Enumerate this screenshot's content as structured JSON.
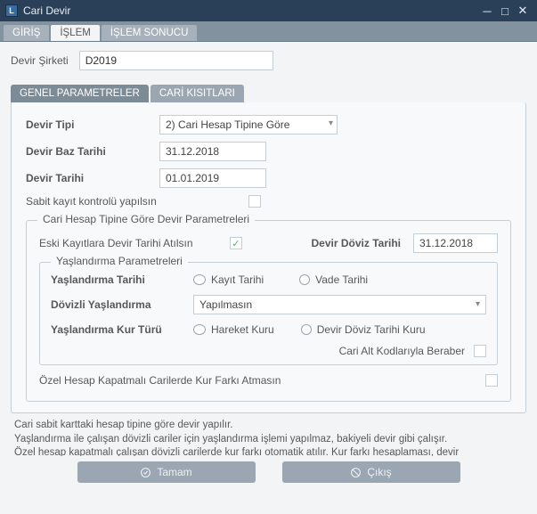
{
  "window": {
    "title": "Cari Devir"
  },
  "tabs": {
    "giris": "GİRİŞ",
    "islem": "İŞLEM",
    "sonuc": "İŞLEM SONUCU"
  },
  "form": {
    "devir_sirketi_label": "Devir Şirketi",
    "devir_sirketi_value": "D2019"
  },
  "subtabs": {
    "genel": "GENEL PARAMETRELER",
    "cari": "CARİ KISITLARI"
  },
  "gp": {
    "devir_tipi_label": "Devir Tipi",
    "devir_tipi_value": "2) Cari Hesap Tipine Göre",
    "devir_baz_tarihi_label": "Devir Baz Tarihi",
    "devir_baz_tarihi_value": "31.12.2018",
    "devir_tarihi_label": "Devir Tarihi",
    "devir_tarihi_value": "01.01.2019",
    "sabit_kayit_label": "Sabit kayıt kontrolü yapılsın"
  },
  "fs": {
    "legend": "Cari Hesap Tipine Göre Devir Parametreleri",
    "eski_kayit_label": "Eski Kayıtlara Devir Tarihi Atılsın",
    "devir_doviz_tarihi_label": "Devir Döviz Tarihi",
    "devir_doviz_tarihi_value": "31.12.2018",
    "yas_legend": "Yaşlandırma Parametreleri",
    "yas_tarihi_label": "Yaşlandırma Tarihi",
    "opt_kayit": "Kayıt Tarihi",
    "opt_vade": "Vade Tarihi",
    "dovizli_yas_label": "Dövizli Yaşlandırma",
    "dovizli_yas_value": "Yapılmasın",
    "yas_kur_label": "Yaşlandırma Kur Türü",
    "opt_hareket": "Hareket Kuru",
    "opt_devir_doviz": "Devir Döviz Tarihi Kuru",
    "cari_alt_label": "Cari Alt Kodlarıyla Beraber",
    "ozel_hesap_label": "Özel Hesap Kapatmalı Carilerde Kur Farkı Atmasın"
  },
  "info": {
    "l1": "Cari sabit karttaki hesap tipine göre devir yapılır.",
    "l2": "Yaşlandırma ile çalışan dövizli cariler için yaşlandırma işlemi yapılmaz, bakiyeli devir gibi çalışır.",
    "l3": "Özel hesap kapatmalı çalışan dövizli carilerde kur farkı otomatik atılır. Kur farkı hesaplaması, devir"
  },
  "buttons": {
    "tamam": "Tamam",
    "cikis": "Çıkış"
  }
}
